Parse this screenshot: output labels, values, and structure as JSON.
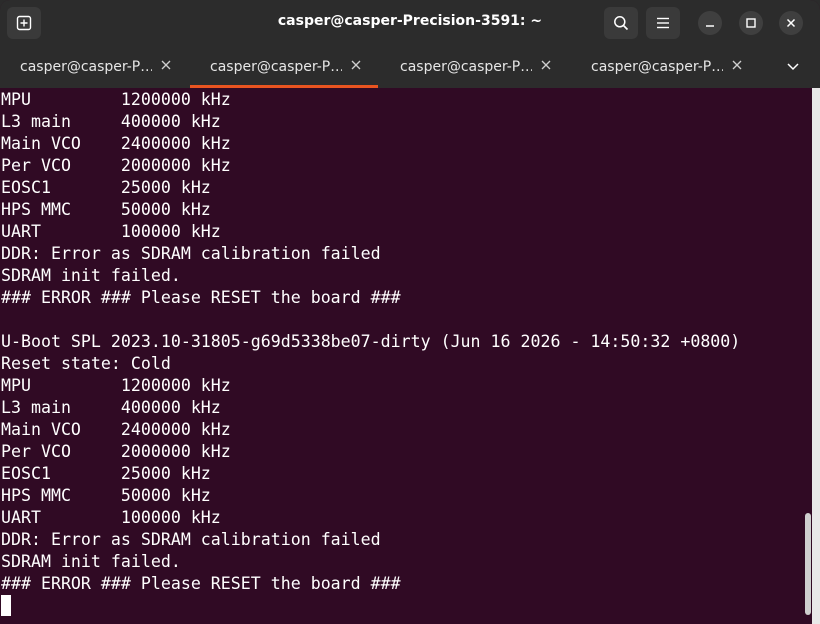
{
  "window": {
    "title": "casper@casper-Precision-3591: ~"
  },
  "tabs": [
    {
      "label": "casper@casper-P…",
      "active": false
    },
    {
      "label": "casper@casper-P…",
      "active": true
    },
    {
      "label": "casper@casper-P…",
      "active": false
    },
    {
      "label": "casper@casper-P…",
      "active": false
    }
  ],
  "icons": {
    "new_tab": "new-tab-icon",
    "search": "search-icon",
    "menu": "hamburger-menu-icon",
    "minimize": "minimize-icon",
    "maximize": "maximize-icon",
    "close": "close-icon",
    "tab_close": "close-icon",
    "tab_overflow": "chevron-down-icon"
  },
  "colors": {
    "terminal_background": "#300a24",
    "terminal_text": "#ffffff",
    "headerbar": "#2c2c2c",
    "active_tab_accent": "#e95420"
  },
  "terminal": {
    "lines": [
      "MPU         1200000 kHz",
      "L3 main     400000 kHz",
      "Main VCO    2400000 kHz",
      "Per VCO     2000000 kHz",
      "EOSC1       25000 kHz",
      "HPS MMC     50000 kHz",
      "UART        100000 kHz",
      "DDR: Error as SDRAM calibration failed",
      "SDRAM init failed.",
      "### ERROR ### Please RESET the board ###",
      "",
      "U-Boot SPL 2023.10-31805-g69d5338be07-dirty (Jun 16 2026 - 14:50:32 +0800)",
      "Reset state: Cold",
      "MPU         1200000 kHz",
      "L3 main     400000 kHz",
      "Main VCO    2400000 kHz",
      "Per VCO     2000000 kHz",
      "EOSC1       25000 kHz",
      "HPS MMC     50000 kHz",
      "UART        100000 kHz",
      "DDR: Error as SDRAM calibration failed",
      "SDRAM init failed.",
      "### ERROR ### Please RESET the board ###"
    ]
  }
}
